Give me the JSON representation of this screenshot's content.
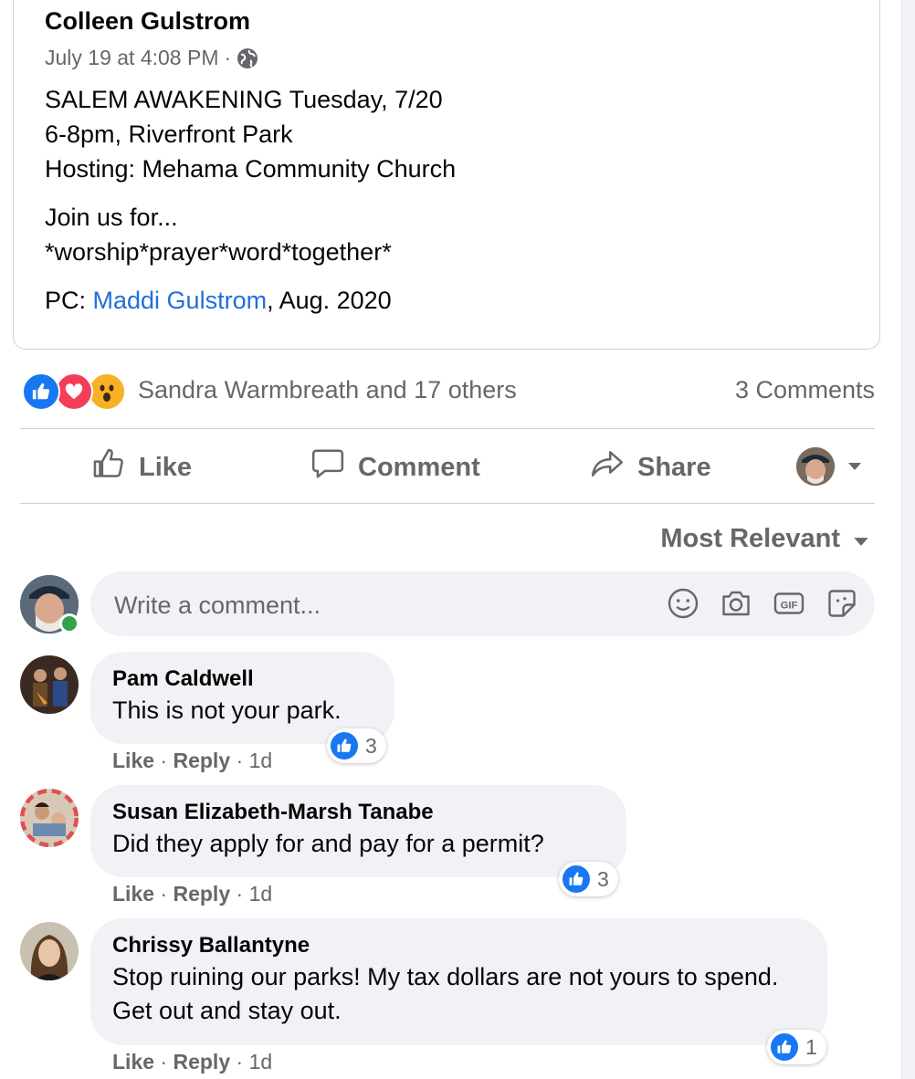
{
  "shared_post": {
    "author": "Colleen Gulstrom",
    "timestamp": "July 19 at 4:08 PM",
    "separator": "·",
    "privacy_icon": "globe-icon",
    "lines": {
      "line1": "SALEM AWAKENING Tuesday, 7/20",
      "line2": "6-8pm, Riverfront Park",
      "line3": "Hosting: Mehama Community Church",
      "line4": "Join us for...",
      "line5": "*worship*prayer*word*together*",
      "pc_prefix": "PC: ",
      "pc_link": "Maddi Gulstrom",
      "pc_suffix": ", Aug. 2020"
    }
  },
  "reactions": {
    "icons": [
      "like-icon",
      "love-icon",
      "wow-icon"
    ],
    "summary": "Sandra Warmbreath and 17 others",
    "comments_count": "3 Comments"
  },
  "actions": {
    "like": "Like",
    "comment": "Comment",
    "share": "Share"
  },
  "sort": {
    "label": "Most Relevant"
  },
  "composer": {
    "placeholder": "Write a comment...",
    "tools": [
      "emoji-icon",
      "camera-icon",
      "gif-icon",
      "sticker-icon"
    ],
    "gif_label": "GIF"
  },
  "comments": [
    {
      "name": "Pam Caldwell",
      "text": "This is not your park.",
      "reactions": "3",
      "like": "Like",
      "reply": "Reply",
      "time": "1d"
    },
    {
      "name": "Susan Elizabeth-Marsh Tanabe",
      "text": "Did they apply for and pay for a permit?",
      "reactions": "3",
      "like": "Like",
      "reply": "Reply",
      "time": "1d"
    },
    {
      "name": "Chrissy Ballantyne",
      "text": "Stop ruining our parks! My tax dollars are not yours to spend. Get out and stay out.",
      "reactions": "1",
      "like": "Like",
      "reply": "Reply",
      "time": "1d"
    }
  ],
  "colors": {
    "accent": "#1877f2",
    "link": "#216fdb",
    "secondary_text": "#65676b",
    "bubble": "#f0f2f5",
    "online": "#31a24c"
  }
}
